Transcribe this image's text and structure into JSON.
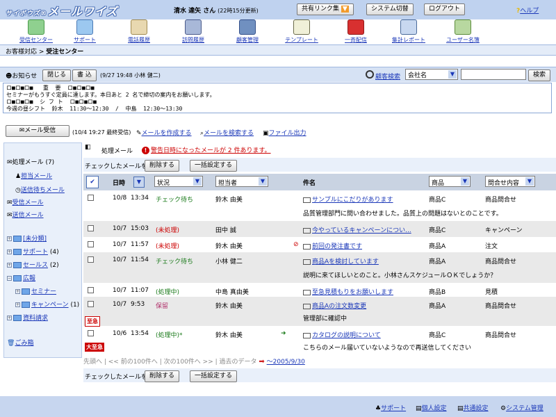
{
  "app": {
    "logo_prefix": "サイボウズ®",
    "logo_main": "メールワイズ",
    "user": "清水 達矢 さん",
    "update_time": "(22時15分更新)",
    "share_link": "共有リンク集",
    "system_switch": "システム切替",
    "logout": "ログアウト",
    "help": "ヘルプ"
  },
  "toolbar": {
    "items": [
      {
        "label": "受信センター",
        "icon": "inbox-icon"
      },
      {
        "label": "サポート",
        "icon": "support-icon"
      },
      {
        "label": "電話履歴",
        "icon": "phone-icon"
      },
      {
        "label": "訪問履歴",
        "icon": "visit-icon"
      },
      {
        "label": "顧客管理",
        "icon": "customer-icon"
      },
      {
        "label": "テンプレート",
        "icon": "template-icon"
      },
      {
        "label": "一斉配信",
        "icon": "mailbox-icon"
      },
      {
        "label": "集計レポート",
        "icon": "report-icon"
      },
      {
        "label": "ユーザー名簿",
        "icon": "users-icon"
      }
    ]
  },
  "breadcrumb": {
    "parent": "お客様対応",
    "sep": " > ",
    "current": "受注センター"
  },
  "notice": {
    "title": "お知らせ",
    "close": "閉じる",
    "write": "書 込",
    "meta": "(9/27 19:48 小林 健二)",
    "body": "ロ■ロ■ロ■   重  要  ロ■ロ■ロ■\nセミナーがもうすぐ定員に達します。本日あと 2 名で締切の案内をお願いします。\nロ■ロ■ロ■  シ フ ト  ロ■ロ■ロ■\n今週の昼シフト  鈴木  11:30〜12:30  /  中島  12:30〜13:30"
  },
  "search": {
    "link": "顧客検索",
    "field": "会社名",
    "button": "検索"
  },
  "actions": {
    "receive": "メール受信",
    "receive_meta": "(10/4 19:27 最終受信)",
    "compose": "メールを作成する",
    "find": "メールを検索する",
    "export": "ファイル出力"
  },
  "sidebar": {
    "processing": "処理メール",
    "processing_count": "(7)",
    "assigned": "担当メール",
    "pending_send": "送信待ちメール",
    "received": "受信メール",
    "sent": "送信メール",
    "folders": [
      {
        "label": "[未分類]",
        "count": ""
      },
      {
        "label": "サポート",
        "count": "(4)"
      },
      {
        "label": "セールス",
        "count": "(2)"
      },
      {
        "label": "広報",
        "count": ""
      },
      {
        "label": "セミナー",
        "count": ""
      },
      {
        "label": "キャンペーン",
        "count": "(1)"
      },
      {
        "label": "資料請求",
        "count": ""
      }
    ],
    "trash": "ごみ箱"
  },
  "main": {
    "header": "処理メール",
    "warning": "警告日時になったメールが 2 件あります。",
    "checked_label": "チェックしたメールを",
    "delete": "削除する",
    "bulk": "一括設定する",
    "columns": {
      "date": "日時",
      "status": "状況",
      "owner": "担当者",
      "subject": "件名",
      "product": "商品",
      "inquiry": "問合せ内容"
    },
    "rows": [
      {
        "date": "10/8",
        "time": "13:34",
        "status": "チェック待ち",
        "owner": "鈴木 由美",
        "subject": "サンプルにこだりがあります",
        "product": "商品C",
        "inquiry": "商品問合せ",
        "body": "品質管理部門に問い合わせました。品質上の問題はないとのことです。",
        "badge": ""
      },
      {
        "date": "10/7",
        "time": "15:03",
        "status": "(未処理)",
        "owner": "田中 誠",
        "subject": "今やっているキャンペーンについ...",
        "product": "商品C",
        "inquiry": "キャンペーン",
        "body": "",
        "badge": ""
      },
      {
        "date": "10/7",
        "time": "11:57",
        "status": "(未処理)",
        "owner": "鈴木 由美",
        "subject": "前回の発注書です",
        "product": "商品A",
        "inquiry": "注文",
        "body": "",
        "badge": ""
      },
      {
        "date": "10/7",
        "time": "11:54",
        "status": "チェック待ち",
        "owner": "小林 健二",
        "subject": "商品Aを検討しています",
        "product": "商品A",
        "inquiry": "商品問合せ",
        "body": "説明に来てほしいとのこと。小林さんスケジュールＯＫでしょうか？",
        "badge": ""
      },
      {
        "date": "10/7",
        "time": "11:07",
        "status": "(処理中)",
        "owner": "中島 真由美",
        "subject": "至急見積もりをお願いします",
        "product": "商品B",
        "inquiry": "見積",
        "body": "",
        "badge": ""
      },
      {
        "date": "10/7",
        "time": "9:53",
        "status": "保留",
        "owner": "鈴木 由美",
        "subject": "商品Aの注文数変更",
        "product": "商品A",
        "inquiry": "商品問合せ",
        "body": "管理部に確認中",
        "badge": "至急"
      },
      {
        "date": "10/6",
        "time": "13:54",
        "status": "(処理中)*",
        "owner": "鈴木 由美",
        "subject": "カタログの説明について",
        "product": "商品C",
        "inquiry": "商品問合せ",
        "body": "こちらのメール届いていないようなので再送信してください",
        "badge": "大至急"
      }
    ],
    "pager": "先頭へ | << 前の100件へ | 次の100件へ >> | 過去のデータ",
    "pager_link": "〜2005/9/30"
  },
  "footer": {
    "support": "サポート",
    "personal": "個人設定",
    "common": "共通設定",
    "system": "システム管理"
  }
}
